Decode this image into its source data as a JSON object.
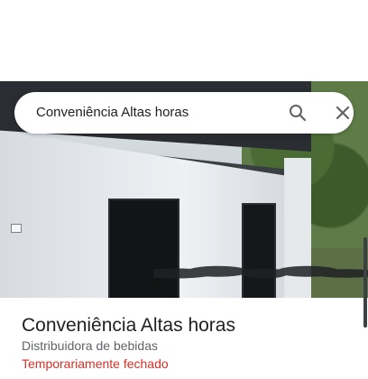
{
  "search": {
    "query": "Conveniência Altas horas",
    "search_icon": "search-icon",
    "close_icon": "close-icon"
  },
  "place": {
    "name": "Conveniência Altas horas",
    "category": "Distribuidora de bebidas",
    "status": "Temporariamente fechado"
  },
  "colors": {
    "status_red": "#d93025",
    "text_primary": "#202124",
    "text_secondary": "#5f6368"
  }
}
